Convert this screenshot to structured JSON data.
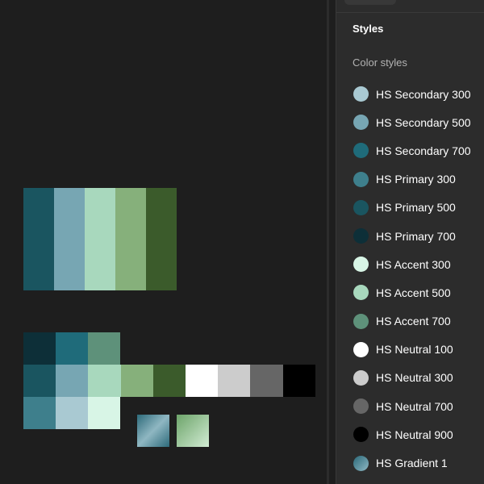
{
  "panel": {
    "title": "Styles",
    "section": "Color styles",
    "styles": [
      {
        "name": "HS Secondary 300",
        "color": "#a9c9d2"
      },
      {
        "name": "HS Secondary 500",
        "color": "#77a6b3"
      },
      {
        "name": "HS Secondary 700",
        "color": "#1f6b7a"
      },
      {
        "name": "HS Primary 300",
        "color": "#3e7f8c"
      },
      {
        "name": "HS Primary 500",
        "color": "#1a5560"
      },
      {
        "name": "HS Primary 700",
        "color": "#0d2f38"
      },
      {
        "name": "HS Accent 300",
        "color": "#d8f5e6"
      },
      {
        "name": "HS Accent 500",
        "color": "#a8d8bd"
      },
      {
        "name": "HS Accent 700",
        "color": "#5e917a"
      },
      {
        "name": "HS Neutral 100",
        "color": "#ffffff"
      },
      {
        "name": "HS Neutral 300",
        "color": "#cccccc"
      },
      {
        "name": "HS Neutral 700",
        "color": "#666666"
      },
      {
        "name": "HS Neutral 900",
        "color": "#000000"
      },
      {
        "name": "HS Gradient 1",
        "color": "linear-gradient(135deg, #2a6878, #8fb8c4)"
      }
    ]
  },
  "canvas": {
    "main_palette": [
      "#1a5560",
      "#77a6b3",
      "#a8d8bd",
      "#86b07b",
      "#3b5b2b"
    ],
    "grid_row1": [
      "#0d2f38",
      "#1f6b7a",
      "#5e917a"
    ],
    "grid_row2": [
      "#1a5560",
      "#77a6b3",
      "#a8d8bd",
      "#86b07b",
      "#3b5b2b",
      "#ffffff",
      "#cccccc",
      "#666666",
      "#000000"
    ],
    "grid_row3": [
      "#3e7f8c",
      "#a9c9d2",
      "#d8f5e6"
    ],
    "gradients": [
      "linear-gradient(135deg, #2d6a7a 0%, #8fb7c2 50%, #2d6a7a 100%)",
      "linear-gradient(135deg, #6da46a 0%, #d2ecd4 100%)"
    ]
  }
}
